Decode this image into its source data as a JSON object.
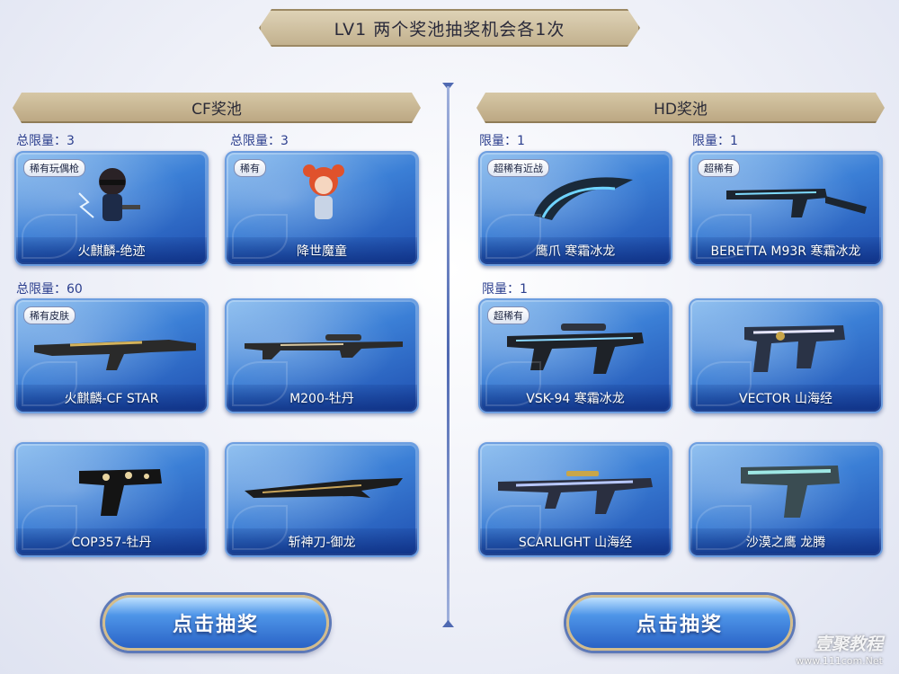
{
  "title": "LV1 两个奖池抽奖机会各1次",
  "pools": [
    {
      "name": "CF奖池",
      "limits": [
        "总限量：3",
        "总限量：3",
        "总限量：60"
      ],
      "items": [
        {
          "badge": "稀有玩偶枪",
          "label": "火麒麟-绝迹"
        },
        {
          "badge": "稀有",
          "label": "降世魔童"
        },
        {
          "badge": "稀有皮肤",
          "label": "火麒麟-CF STAR"
        },
        {
          "badge": "",
          "label": "M200-牡丹"
        },
        {
          "badge": "",
          "label": "COP357-牡丹"
        },
        {
          "badge": "",
          "label": "斩神刀-御龙"
        }
      ],
      "button": "点击抽奖"
    },
    {
      "name": "HD奖池",
      "limits": [
        "限量：1",
        "限量：1",
        "限量：1"
      ],
      "items": [
        {
          "badge": "超稀有近战",
          "label": "鹰爪 寒霜冰龙"
        },
        {
          "badge": "超稀有",
          "label": "BERETTA M93R 寒霜冰龙"
        },
        {
          "badge": "超稀有",
          "label": "VSK-94 寒霜冰龙"
        },
        {
          "badge": "",
          "label": "VECTOR 山海经"
        },
        {
          "badge": "",
          "label": "SCARLIGHT 山海经"
        },
        {
          "badge": "",
          "label": "沙漠之鹰 龙腾"
        }
      ],
      "button": "点击抽奖"
    }
  ],
  "watermark": {
    "title": "壹聚教程",
    "url": "www.111com.Net"
  }
}
